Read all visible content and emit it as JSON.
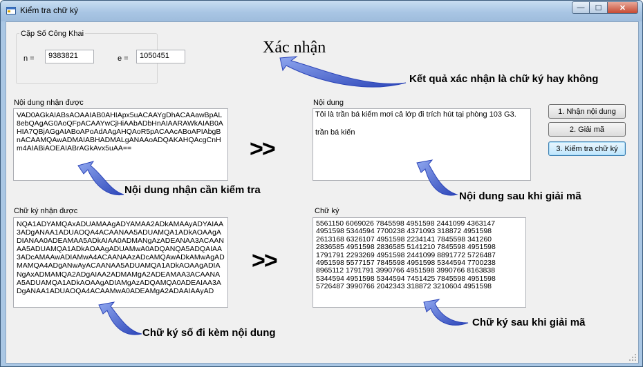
{
  "window": {
    "title": "Kiểm tra chữ ký"
  },
  "titlebar_buttons": {
    "minimize": "—",
    "maximize": "☐",
    "close": "✕"
  },
  "key_group": {
    "legend": "Cặp Số Công Khai",
    "n_label": "n =",
    "n_value": "9383821",
    "e_label": "e =",
    "e_value": "1050451"
  },
  "received_content": {
    "label": "Nội dung nhận được",
    "value": "VAD0AGkAIABsAOAAIAB0AHIApx5uACAAYgDhACAAawBpAL8ebQAgAG0AoQFpACAAYwCjHiAAbADbHnAIAARAWkAIAB0AHIA7QBjAGgAIABoAPoAdAAgAHQAoR5pACAAcABoAPIAbgBnACAAMQAwADMAIABHADMALgANAAoADQAKAHQAcgCnHm4AIABiAOEAIABrAGkAvx5uAA=="
  },
  "decoded_content": {
    "label": "Nội dung",
    "line1": "Tôi là trần bá kiếm mơi cả lớp đi trích hút tại phòng 103 G3.",
    "line2": "trần bá kiến"
  },
  "received_signature": {
    "label": "Chữ ký nhận được",
    "value": "NQA1ADYAMQAxADUAMAAgADYAMAA2ADkAMAAyADYAIAA3ADgANAA1ADUAOQA4ACAANAA5ADUAMQA1ADkAOAAgADIANAA0ADEAMAA5ADkAIAA0ADMANgAzADEANAA3ACAANAA5ADUAMQA1ADkAOAAgADUAMwA0ADQANQA5ADQAIAA3ADcAMAAwADIAMwA4ACAANAAzADcAMQAwADkAMwAgADMAMQA4ADgANwAyACAANAA5ADUAMQA1ADkAOAAgADIANgAxADMAMQA2ADgAIAA2ADMAMgA2ADEAMAA3ACAANAA5ADUAMQA1ADkAOAAgADIAMgAzADQAMQA0ADEAIAA3ADgANAA1ADUAOQA4ACAAMwA0ADEAMgA2ADAAIAAyAD"
  },
  "decoded_signature": {
    "label": "Chữ ký",
    "lines": [
      "5561150 6069026 7845598 4951598 2441099 4363147",
      "4951598 5344594 7700238 4371093 318872 4951598",
      "2613168 6326107 4951598 2234141 7845598 341260",
      "2836585 4951598 2836585 5141210 7845598 4951598",
      "1791791 2293269 4951598 2441099 8891772 5726487",
      "4951598 5577157 7845598 4951598 5344594 7700238",
      "8965112 1791791 3990766 4951598 3990766 8163838",
      "5344594 4951598 5344594 7451425 7845598 4951598",
      "5726487 3990766 2042343 318872 3210604 4951598"
    ]
  },
  "buttons": {
    "receive": "1. Nhận nội dung",
    "decrypt": "2. Giải mã",
    "verify": "3. Kiểm tra chữ ký"
  },
  "arrows": {
    "top": ">>",
    "bottom": ">>"
  },
  "annotations": {
    "verify_title": "Xác nhận",
    "verify_result": "Kết quả xác nhận là chữ ký hay không",
    "received_content": "Nội dung nhận cần kiểm tra",
    "decoded_content": "Nội dung sau khi giải mã",
    "received_signature": "Chữ ký số đi kèm nội dung",
    "decoded_signature": "Chữ ký sau khi giải mã"
  },
  "colors": {
    "annotation_arrow": "#3d56c9",
    "titlebar": "#aac7e4",
    "client_bg": "#f0f0f0"
  }
}
